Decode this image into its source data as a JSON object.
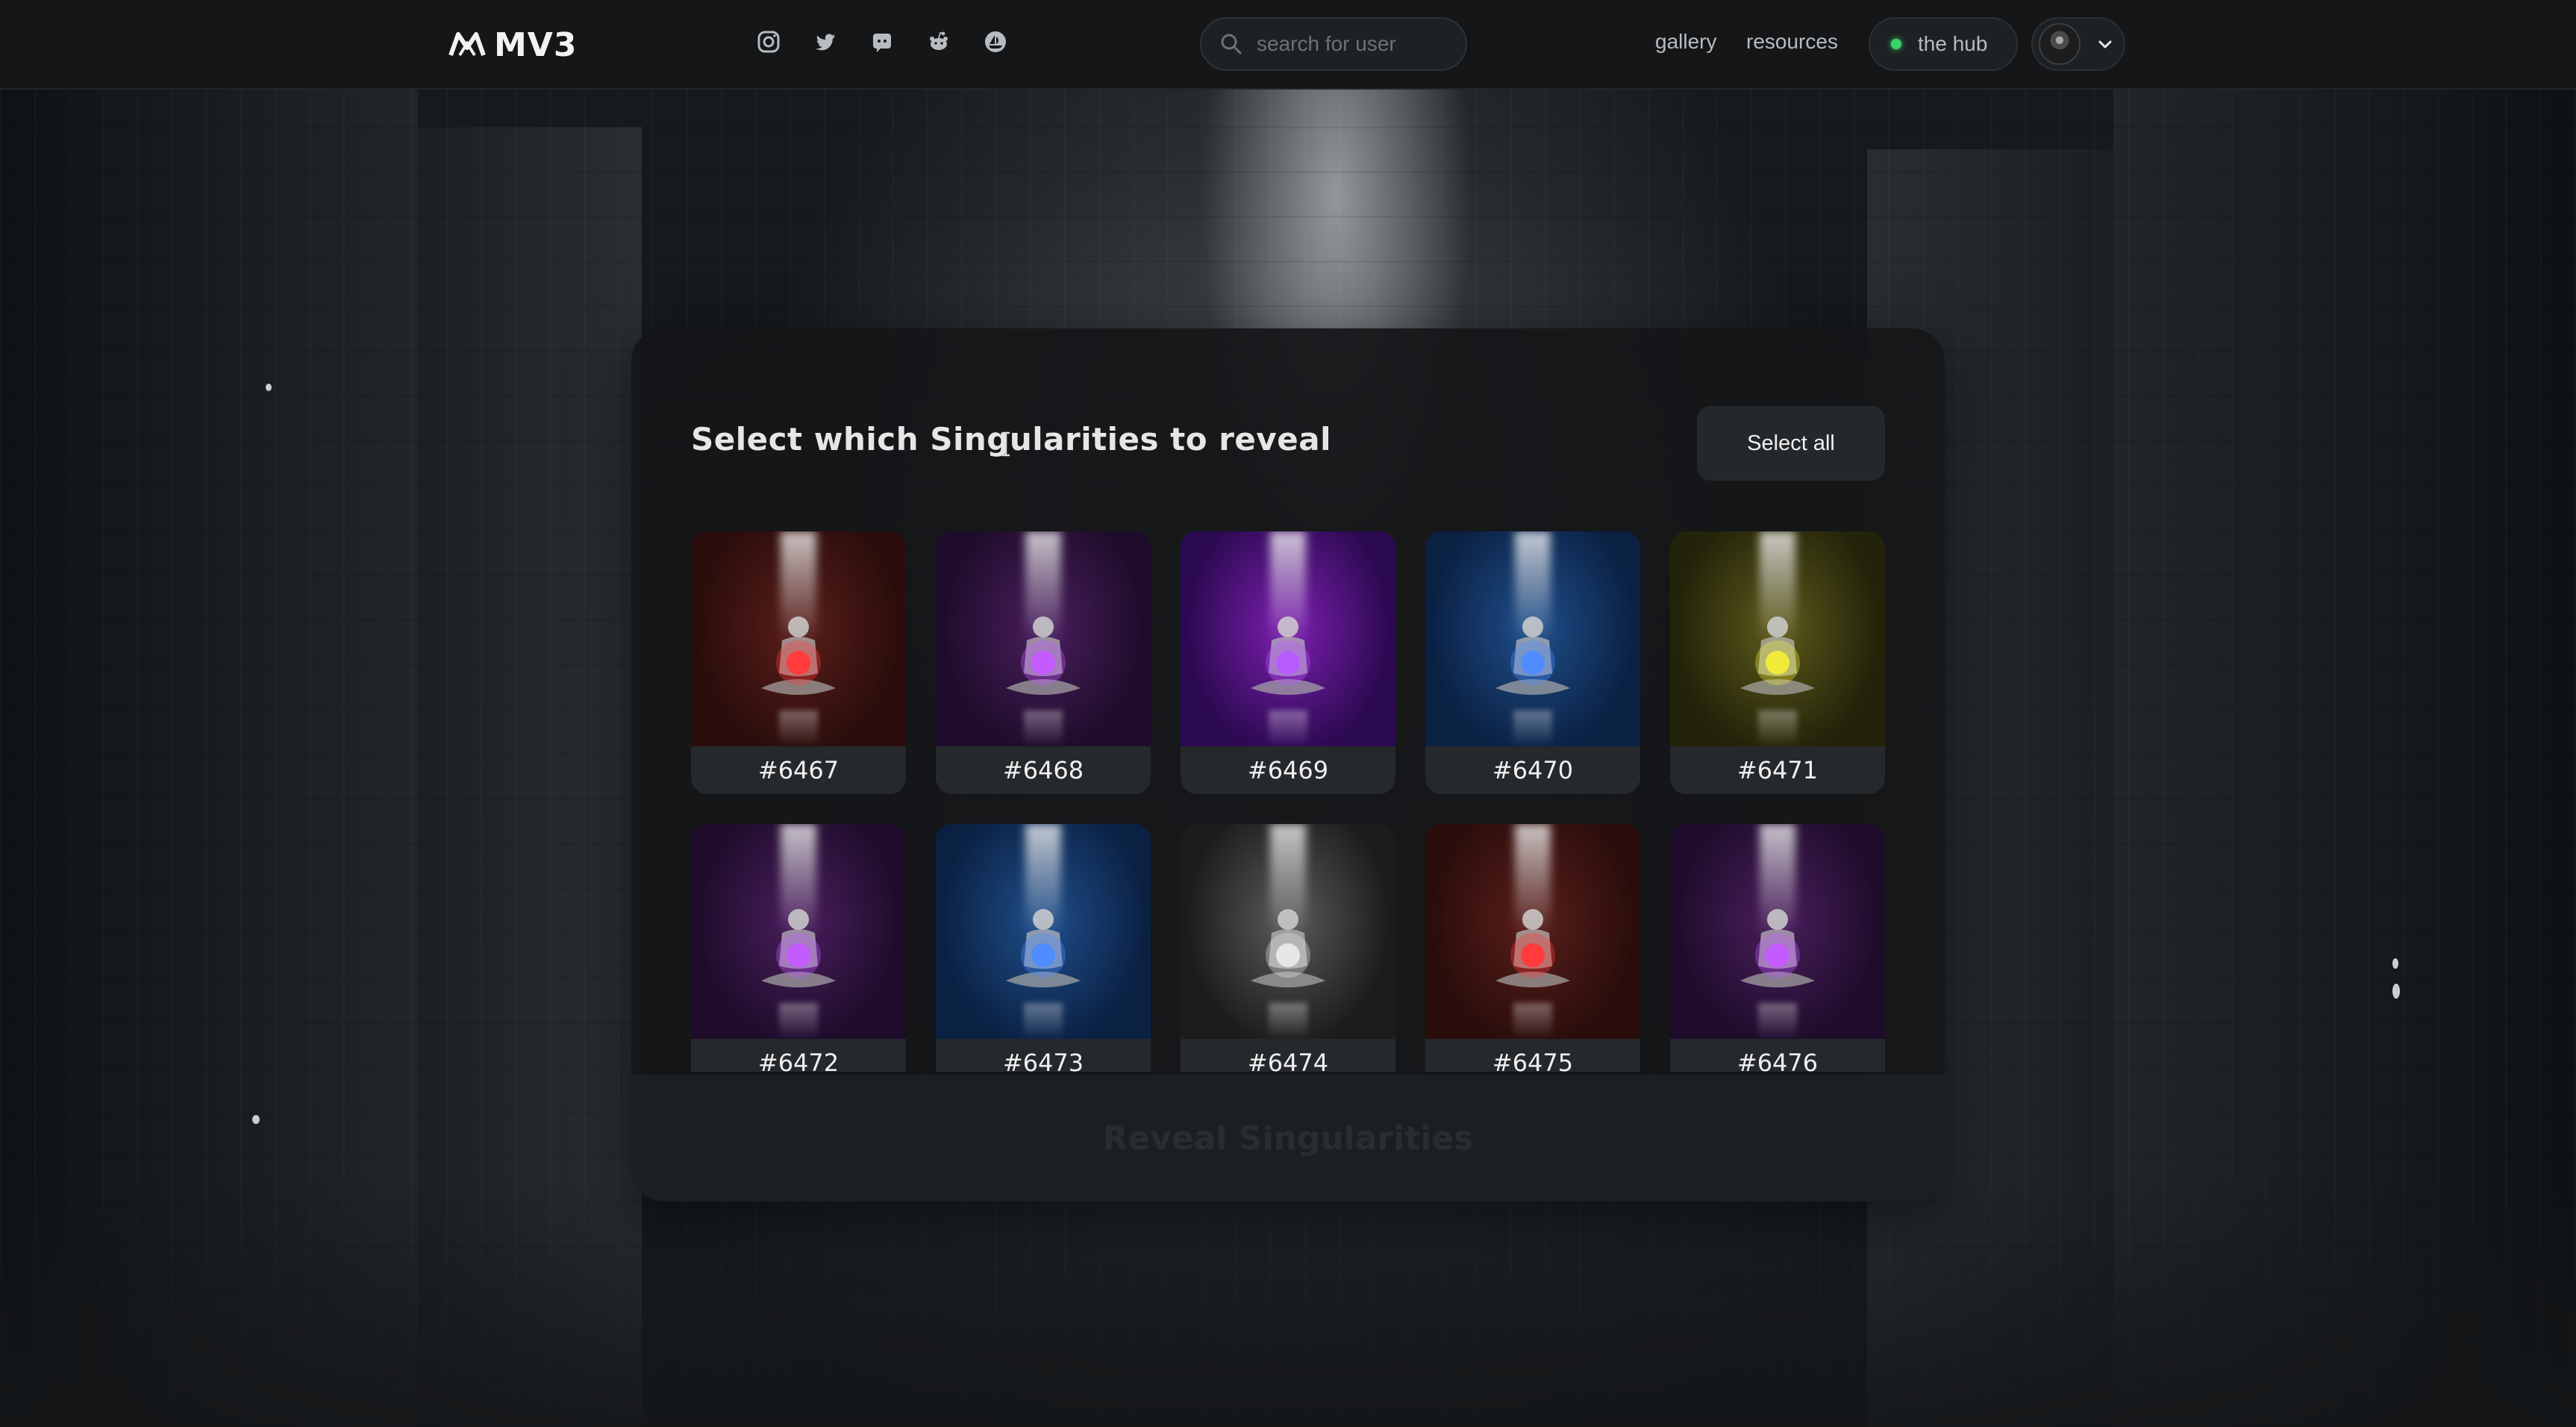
{
  "header": {
    "logo_text": "MV3",
    "socials": [
      {
        "name": "instagram-icon"
      },
      {
        "name": "twitter-icon"
      },
      {
        "name": "discord-icon"
      },
      {
        "name": "reddit-icon"
      },
      {
        "name": "opensea-icon"
      }
    ],
    "search": {
      "placeholder": "search for user",
      "value": ""
    },
    "nav": {
      "gallery": "gallery",
      "resources": "resources"
    },
    "hub": {
      "label": "the hub",
      "status_color": "#3ad36a"
    }
  },
  "modal": {
    "title": "Select which Singularities to reveal",
    "select_all_label": "Select all",
    "reveal_label": "Reveal Singularities",
    "cards": [
      {
        "id": "#6467",
        "colors": [
          "#5a1e1a",
          "#2a0d0b"
        ],
        "glow": "#ff3b3b"
      },
      {
        "id": "#6468",
        "colors": [
          "#4a1e5e",
          "#1e0c2a"
        ],
        "glow": "#c35bff"
      },
      {
        "id": "#6469",
        "colors": [
          "#7d1fb0",
          "#2c0a52"
        ],
        "glow": "#b85cff"
      },
      {
        "id": "#6470",
        "colors": [
          "#1f4f8c",
          "#0b2144"
        ],
        "glow": "#4f8dff"
      },
      {
        "id": "#6471",
        "colors": [
          "#5d5a1a",
          "#23230a"
        ],
        "glow": "#f2ea3b"
      },
      {
        "id": "#6472",
        "colors": [
          "#4a1e5e",
          "#1e0c2a"
        ],
        "glow": "#c35bff"
      },
      {
        "id": "#6473",
        "colors": [
          "#1f4f8c",
          "#0b2144"
        ],
        "glow": "#4f8dff"
      },
      {
        "id": "#6474",
        "colors": [
          "#5b5b5b",
          "#1c1c1c"
        ],
        "glow": "#e6e6e6"
      },
      {
        "id": "#6475",
        "colors": [
          "#5a1e1a",
          "#2a0d0b"
        ],
        "glow": "#ff3b3b"
      },
      {
        "id": "#6476",
        "colors": [
          "#4a1e5e",
          "#1e0c2a"
        ],
        "glow": "#c35bff"
      }
    ]
  }
}
